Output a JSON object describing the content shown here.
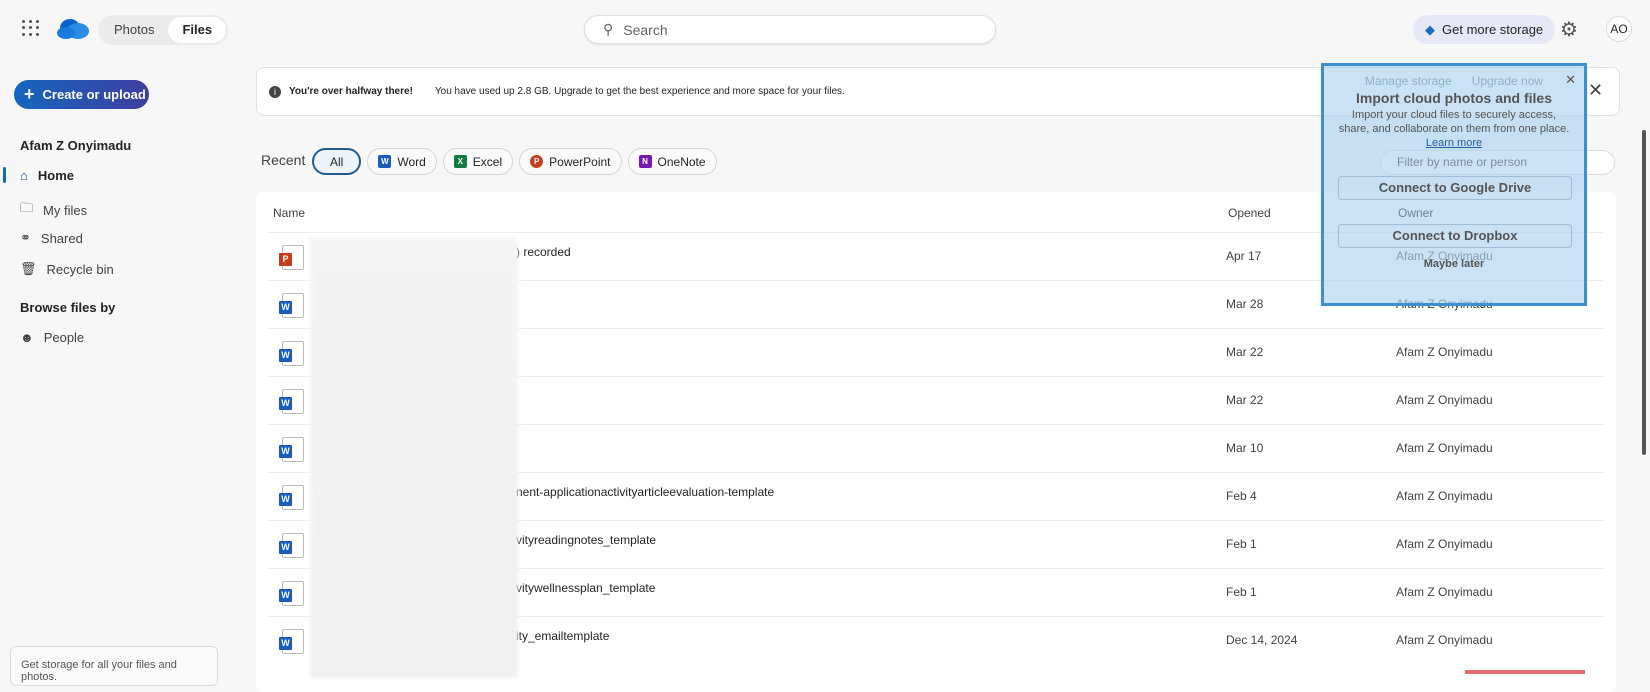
{
  "header": {
    "tabs": [
      {
        "label": "Photos"
      },
      {
        "label": "Files",
        "active": true
      }
    ],
    "search_placeholder": "Search",
    "storage_label": "Get more storage",
    "avatar_initials": "AO"
  },
  "sidebar": {
    "create_label": "Create or upload",
    "user_name": "Afam Z Onyimadu",
    "items": [
      {
        "label": "Home",
        "icon": "home-icon",
        "active": true
      },
      {
        "label": "My files",
        "icon": "folder-icon"
      },
      {
        "label": "Shared",
        "icon": "people-icon"
      },
      {
        "label": "Recycle bin",
        "icon": "trash-icon"
      }
    ],
    "browse_heading": "Browse files by",
    "browse_items": [
      {
        "label": "People",
        "icon": "person-icon"
      }
    ],
    "storage_card": "Get storage for all your files and photos."
  },
  "banner": {
    "title": "You're over halfway there!",
    "message": "You have used up 2.8 GB. Upgrade to get the best experience and more space for your files."
  },
  "filters": {
    "label": "Recent",
    "pills": [
      "All",
      "Word",
      "Excel",
      "PowerPoint",
      "OneNote"
    ],
    "filter_placeholder": "Filter by name or person"
  },
  "table": {
    "columns": [
      "Name",
      "Opened",
      "Owner"
    ],
    "rows": [
      {
        "type": "ppt",
        "name": ") recorded",
        "opened": "Apr 17",
        "owner": "Afam Z Onyimadu"
      },
      {
        "type": "word",
        "name": "",
        "opened": "Mar 28",
        "owner": "Afam Z Onyimadu"
      },
      {
        "type": "word",
        "name": "",
        "opened": "Mar 22",
        "owner": "Afam Z Onyimadu"
      },
      {
        "type": "word",
        "name": "",
        "opened": "Mar 22",
        "owner": "Afam Z Onyimadu"
      },
      {
        "type": "word",
        "name": "",
        "opened": "Mar 10",
        "owner": "Afam Z Onyimadu"
      },
      {
        "type": "word",
        "name": "nent-applicationactivityarticleevaluation-template",
        "opened": "Feb 4",
        "owner": "Afam Z Onyimadu"
      },
      {
        "type": "word",
        "name": "vityreadingnotes_template",
        "opened": "Feb 1",
        "owner": "Afam Z Onyimadu"
      },
      {
        "type": "word",
        "name": "vitywellnessplan_template",
        "opened": "Feb 1",
        "owner": "Afam Z Onyimadu"
      },
      {
        "type": "word",
        "name": "ity_emailtemplate",
        "opened": "Dec 14, 2024",
        "owner": "Afam Z Onyimadu"
      }
    ]
  },
  "popup": {
    "manage_storage": "Manage storage",
    "upgrade_now": "Upgrade now",
    "title": "Import cloud photos and files",
    "description": "Import your cloud files to securely access, share, and collaborate on them from one place.",
    "learn_more": "Learn more",
    "google_drive": "Connect to Google Drive",
    "dropbox": "Connect to Dropbox",
    "maybe_later": "Maybe later"
  },
  "colors": {
    "accent": "#0f6cbd",
    "word": "#185abd",
    "excel": "#107c41",
    "powerpoint": "#c43e1c",
    "onenote": "#7719aa"
  }
}
